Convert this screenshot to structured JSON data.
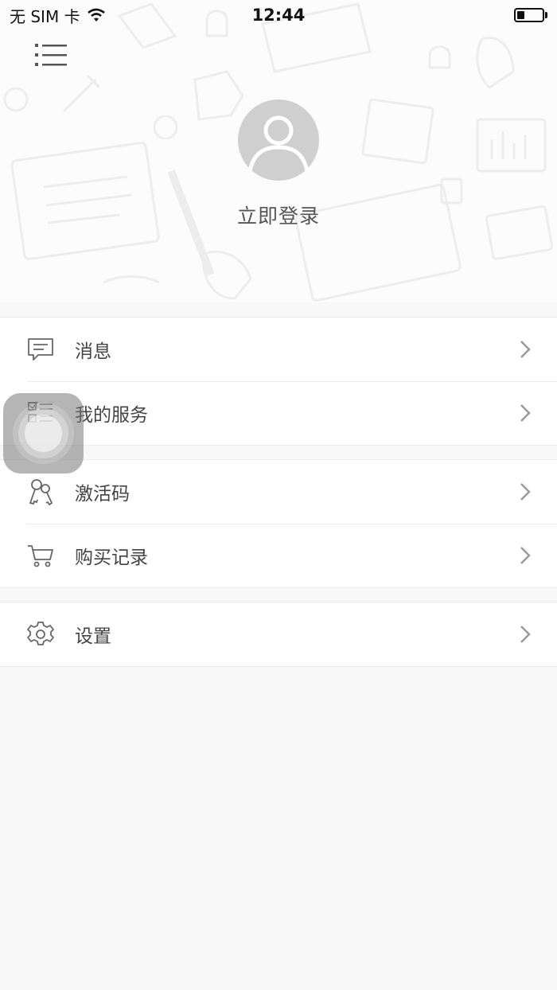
{
  "status_bar": {
    "carrier": "无 SIM 卡",
    "time": "12:44",
    "battery_level": 0.3
  },
  "header": {
    "menu_icon": "list-menu-icon",
    "avatar_icon": "default-avatar-icon",
    "login_label": "立即登录"
  },
  "menu_groups": [
    {
      "items": [
        {
          "label": "消息",
          "icon": "message-icon"
        },
        {
          "label": "我的服务",
          "icon": "service-checklist-icon"
        }
      ]
    },
    {
      "items": [
        {
          "label": "激活码",
          "icon": "keys-icon"
        },
        {
          "label": "购买记录",
          "icon": "cart-icon"
        }
      ]
    },
    {
      "items": [
        {
          "label": "设置",
          "icon": "gear-icon"
        }
      ]
    }
  ],
  "colors": {
    "background": "#f8f8f8",
    "header_background": "#fcfcfc",
    "avatar": "#cfcfcf",
    "icon_stroke": "#666666",
    "chevron": "#999999"
  }
}
